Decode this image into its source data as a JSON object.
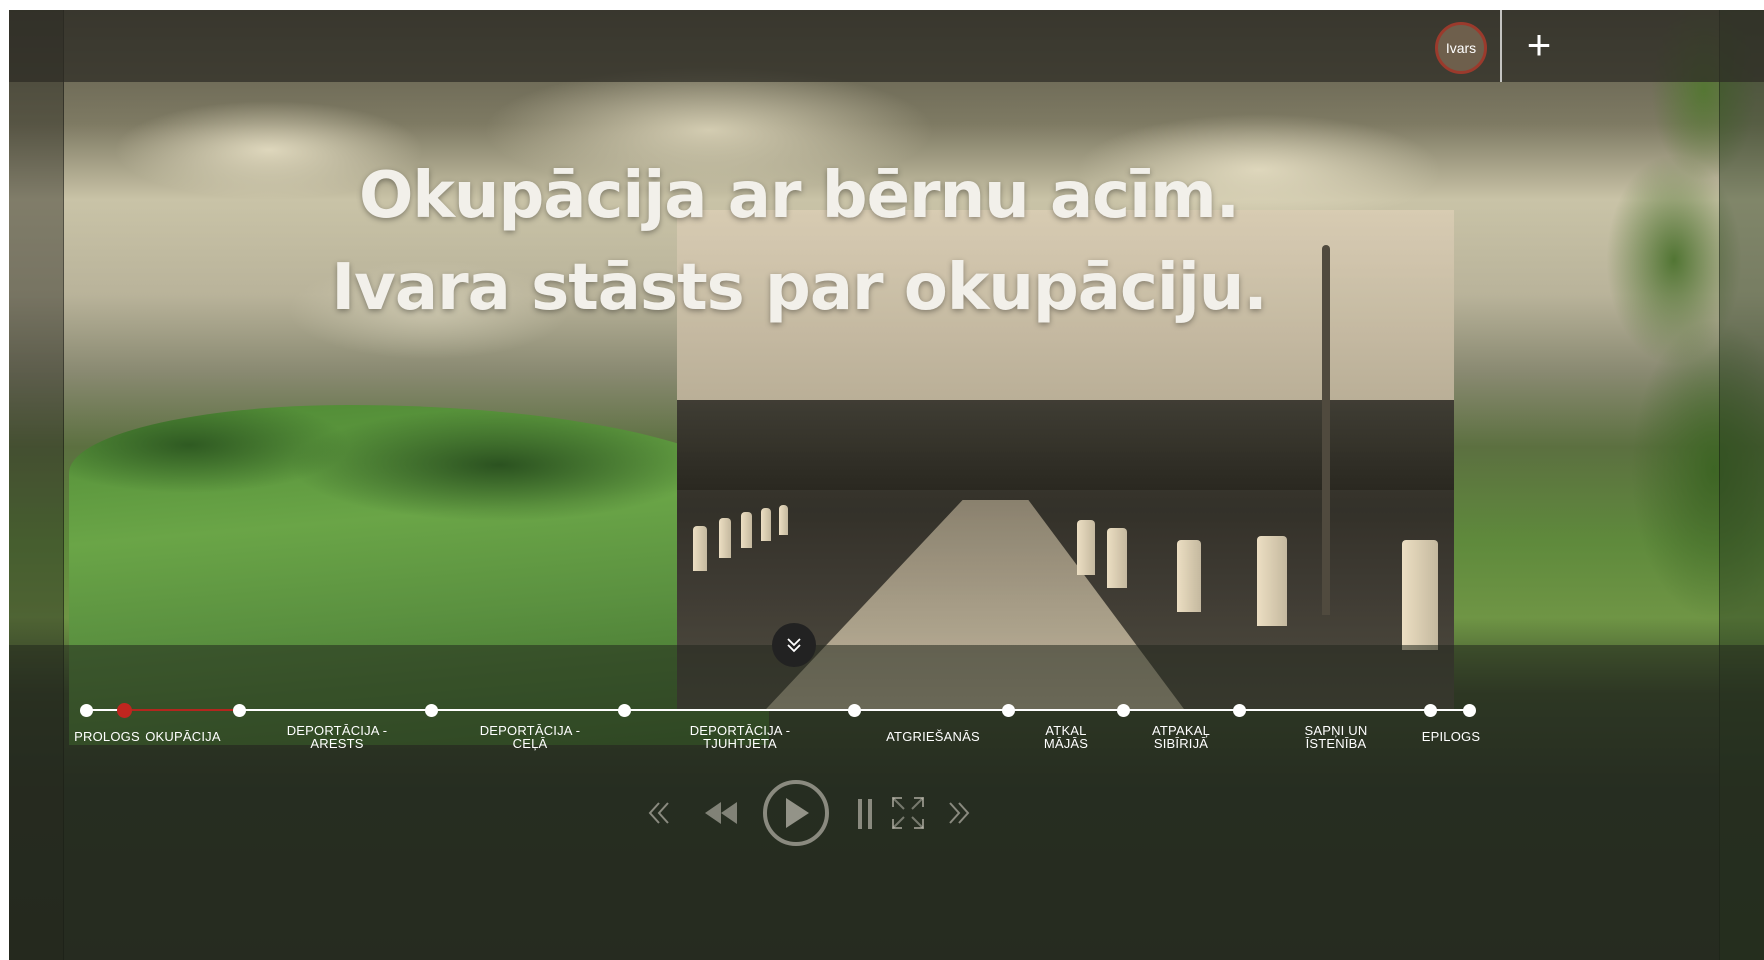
{
  "header": {
    "user_name": "Ivars",
    "add_label": "+"
  },
  "hero": {
    "title_line1": "Okupācija ar bērnu acīm.",
    "title_line2": "Ivara stāsts par okupāciju."
  },
  "timeline": {
    "items": [
      {
        "label": "PROLOGS"
      },
      {
        "label": "OKUPĀCIJA"
      },
      {
        "label": "DEPORTĀCIJA -\nARESTS"
      },
      {
        "label": "DEPORTĀCIJA -\nCEĻĀ"
      },
      {
        "label": "DEPORTĀCIJA -\nTJUHTJETA"
      },
      {
        "label": "ATGRIEŠANĀS"
      },
      {
        "label": "ATKAL\nMĀJĀS"
      },
      {
        "label": "ATPAKAĻ\nSIBĪRIJĀ"
      },
      {
        "label": "SAPŅI UN\nĪSTENĪBA"
      },
      {
        "label": "EPILOGS"
      }
    ],
    "active_index": 1,
    "accent_color": "#c0261f"
  },
  "player": {
    "icons": [
      "chevrons-left-icon",
      "rewind-icon",
      "play-icon",
      "pause-icon",
      "fullscreen-icon",
      "chevrons-right-icon"
    ]
  }
}
